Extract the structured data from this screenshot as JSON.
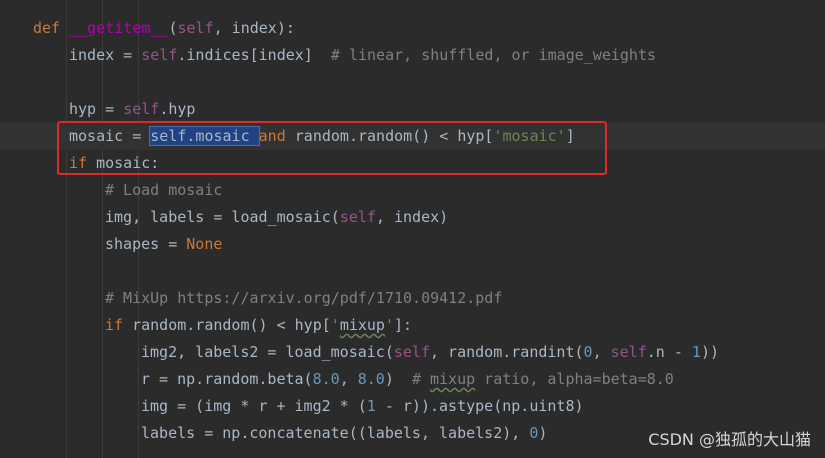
{
  "code_lines": [
    {
      "indent": 0,
      "tokens": [
        {
          "t": "def ",
          "c": "keyword"
        },
        {
          "t": "__getitem__",
          "c": "func"
        },
        {
          "t": "(",
          "c": "plain"
        },
        {
          "t": "self",
          "c": "self"
        },
        {
          "t": ", index):",
          "c": "plain"
        }
      ]
    },
    {
      "indent": 1,
      "tokens": [
        {
          "t": "index = ",
          "c": "plain"
        },
        {
          "t": "self",
          "c": "self"
        },
        {
          "t": ".indices[index]  ",
          "c": "plain"
        },
        {
          "t": "# linear, shuffled, or image_weights",
          "c": "comment"
        }
      ]
    },
    {
      "indent": 1,
      "tokens": []
    },
    {
      "indent": 1,
      "tokens": [
        {
          "t": "hyp = ",
          "c": "plain"
        },
        {
          "t": "self",
          "c": "self"
        },
        {
          "t": ".hyp",
          "c": "plain"
        }
      ]
    },
    {
      "indent": 1,
      "tokens": [
        {
          "t": "mosaic = ",
          "c": "plain"
        },
        {
          "t": "self.mosaic ",
          "c": "select"
        },
        {
          "t": "and ",
          "c": "keyword"
        },
        {
          "t": "random.random() < hyp[",
          "c": "plain"
        },
        {
          "t": "'mosaic'",
          "c": "string"
        },
        {
          "t": "]",
          "c": "plain"
        }
      ]
    },
    {
      "indent": 1,
      "tokens": [
        {
          "t": "if ",
          "c": "keyword"
        },
        {
          "t": "mosaic:",
          "c": "plain"
        }
      ]
    },
    {
      "indent": 2,
      "tokens": [
        {
          "t": "# Load mosaic",
          "c": "comment"
        }
      ]
    },
    {
      "indent": 2,
      "tokens": [
        {
          "t": "img, labels = load_mosaic(",
          "c": "plain"
        },
        {
          "t": "self",
          "c": "self"
        },
        {
          "t": ", index)",
          "c": "plain"
        }
      ]
    },
    {
      "indent": 2,
      "tokens": [
        {
          "t": "shapes = ",
          "c": "plain"
        },
        {
          "t": "None",
          "c": "keyword"
        }
      ]
    },
    {
      "indent": 2,
      "tokens": []
    },
    {
      "indent": 2,
      "tokens": [
        {
          "t": "# MixUp https://arxiv.org/pdf/1710.09412.pdf",
          "c": "comment"
        }
      ]
    },
    {
      "indent": 2,
      "tokens": [
        {
          "t": "if ",
          "c": "keyword"
        },
        {
          "t": "random.random() < hyp[",
          "c": "plain"
        },
        {
          "t": "'",
          "c": "string"
        },
        {
          "t": "mixup",
          "c": "typo"
        },
        {
          "t": "'",
          "c": "string"
        },
        {
          "t": "]:",
          "c": "plain"
        }
      ]
    },
    {
      "indent": 3,
      "tokens": [
        {
          "t": "img2, labels2 = load_mosaic(",
          "c": "plain"
        },
        {
          "t": "self",
          "c": "self"
        },
        {
          "t": ", random.randint(",
          "c": "plain"
        },
        {
          "t": "0",
          "c": "number"
        },
        {
          "t": ", ",
          "c": "plain"
        },
        {
          "t": "self",
          "c": "self"
        },
        {
          "t": ".n - ",
          "c": "plain"
        },
        {
          "t": "1",
          "c": "number"
        },
        {
          "t": "))",
          "c": "plain"
        }
      ]
    },
    {
      "indent": 3,
      "tokens": [
        {
          "t": "r = np.random.beta(",
          "c": "plain"
        },
        {
          "t": "8.0",
          "c": "number"
        },
        {
          "t": ", ",
          "c": "plain"
        },
        {
          "t": "8.0",
          "c": "number"
        },
        {
          "t": ")  ",
          "c": "plain"
        },
        {
          "t": "# ",
          "c": "comment"
        },
        {
          "t": "mixup",
          "c": "select-comment"
        },
        {
          "t": " ratio, alpha=beta=8.0",
          "c": "comment"
        }
      ]
    },
    {
      "indent": 3,
      "tokens": [
        {
          "t": "img = (img * r + img2 * (",
          "c": "plain"
        },
        {
          "t": "1",
          "c": "number"
        },
        {
          "t": " - r)).astype(np.uint8)",
          "c": "plain"
        }
      ]
    },
    {
      "indent": 3,
      "tokens": [
        {
          "t": "labels = np.concatenate((labels, labels2), ",
          "c": "plain"
        },
        {
          "t": "0",
          "c": "number"
        },
        {
          "t": ")",
          "c": "plain"
        }
      ]
    }
  ],
  "watermark": "CSDN @独孤的大山猫",
  "colors": {
    "background": "#2b2b2b",
    "annotation_box": "#e0292b",
    "selection": "#214283"
  }
}
